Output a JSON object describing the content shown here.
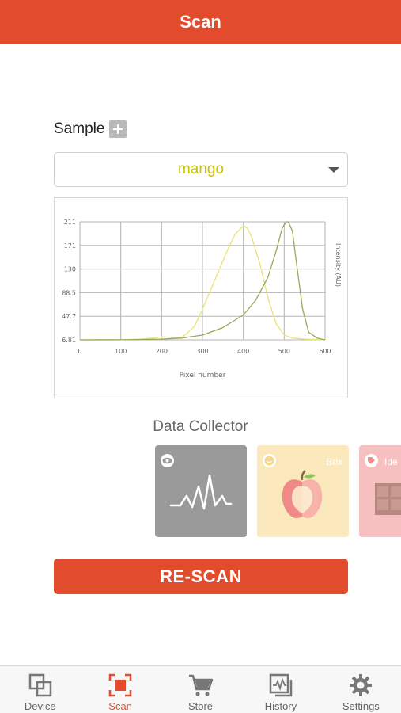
{
  "header": {
    "title": "Scan"
  },
  "sample": {
    "label": "Sample",
    "add_icon": "plus-icon",
    "selected": "mango",
    "options": [
      "mango"
    ]
  },
  "chart_data": {
    "type": "line",
    "xlabel": "Pixel number",
    "ylabel": "Intensity (AU)",
    "xlim": [
      0,
      600
    ],
    "ylim": [
      6.81,
      211
    ],
    "x_ticks": [
      "0",
      "100",
      "200",
      "300",
      "400",
      "500",
      "600"
    ],
    "y_ticks": [
      "211",
      "171",
      "130",
      "88.5",
      "47.7",
      "6.81"
    ],
    "grid": true,
    "series": [
      {
        "color": "#ebe27a",
        "x": [
          0,
          100,
          150,
          180,
          200,
          220,
          250,
          280,
          300,
          330,
          360,
          380,
          400,
          410,
          420,
          440,
          460,
          480,
          500,
          520,
          550,
          600
        ],
        "y": [
          6.81,
          7,
          8,
          10,
          12,
          11,
          11,
          30,
          60,
          110,
          160,
          190,
          204,
          200,
          185,
          140,
          80,
          35,
          15,
          10,
          8,
          6.81
        ]
      },
      {
        "color": "#9aa65a",
        "x": [
          0,
          100,
          200,
          250,
          300,
          350,
          400,
          430,
          460,
          480,
          495,
          505,
          510,
          520,
          530,
          545,
          560,
          580,
          600
        ],
        "y": [
          6.81,
          7,
          8,
          10,
          15,
          28,
          50,
          75,
          115,
          160,
          200,
          211,
          211,
          195,
          140,
          60,
          20,
          10,
          6.81
        ]
      }
    ]
  },
  "data_collector": {
    "title": "Data Collector",
    "cards": [
      {
        "icon": "eye-icon",
        "image": "waveform-icon",
        "color": "#9a9a9a"
      },
      {
        "icon": "smiley-icon",
        "image": "apple-icon",
        "tag": "Brix",
        "color": "#fbe8bd"
      },
      {
        "icon": "tag-icon",
        "image": "chocolate-icon",
        "tag": "Ide",
        "color": "#f6c0c0"
      }
    ]
  },
  "actions": {
    "rescan_label": "RE-SCAN"
  },
  "nav": {
    "items": [
      {
        "label": "Device",
        "icon": "device-icon",
        "active": false
      },
      {
        "label": "Scan",
        "icon": "scan-icon",
        "active": true
      },
      {
        "label": "Store",
        "icon": "cart-icon",
        "active": false
      },
      {
        "label": "History",
        "icon": "history-icon",
        "active": false
      },
      {
        "label": "Settings",
        "icon": "gear-icon",
        "active": false
      }
    ]
  },
  "colors": {
    "accent": "#e24c2c",
    "sample_value": "#c9c300"
  }
}
